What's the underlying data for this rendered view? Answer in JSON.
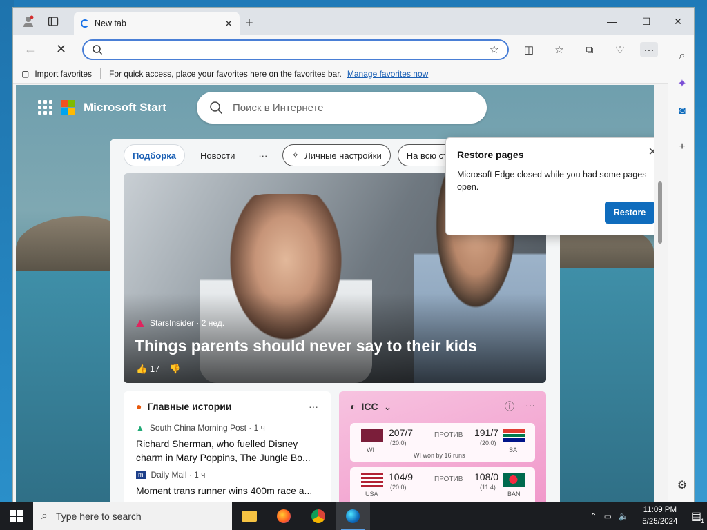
{
  "browser": {
    "tab_title": "New tab",
    "address_value": "",
    "favbar": {
      "import_label": "Import favorites",
      "hint_text": "For quick access, place your favorites here on the favorites bar.",
      "manage_link": "Manage favorites now"
    }
  },
  "start_page": {
    "brand": "Microsoft Start",
    "search_placeholder": "Поиск в Интернете",
    "pills": [
      "Подборка",
      "Новости",
      "···",
      "Личные настройки",
      "На всю страницу"
    ],
    "hero": {
      "source": "StarsInsider · 2 нед.",
      "title": "Things parents should never say to their kids",
      "likes": "17"
    },
    "top_stories": {
      "header": "Главные истории",
      "stories": [
        {
          "source": "South China Morning Post · 1 ч",
          "title": "Richard Sherman, who fuelled Disney charm in Mary Poppins, The Jungle Bo..."
        },
        {
          "source": "Daily Mail · 1 ч",
          "title": "Moment trans runner wins 400m race a..."
        }
      ]
    },
    "icc": {
      "header": "ICC",
      "matches": [
        {
          "team1": "WI",
          "score1": "207/7",
          "overs1": "(20.0)",
          "vs": "ПРОТИВ",
          "team2": "SA",
          "score2": "191/7",
          "overs2": "(20.0)",
          "result": "WI won by 16 runs"
        },
        {
          "team1": "USA",
          "score1": "104/9",
          "overs1": "(20.0)",
          "vs": "ПРОТИВ",
          "team2": "BAN",
          "score2": "108/0",
          "overs2": "(11.4)",
          "result": ""
        }
      ]
    }
  },
  "popup": {
    "title": "Restore pages",
    "message": "Microsoft Edge closed while you had some pages open.",
    "button": "Restore"
  },
  "taskbar": {
    "search_placeholder": "Type here to search",
    "time": "11:09 PM",
    "date": "5/25/2024",
    "notification_count": "1"
  },
  "colors": {
    "accent": "#0f6cbd",
    "taskbar": "#1b1d21",
    "icc_card": "#f096c9"
  }
}
